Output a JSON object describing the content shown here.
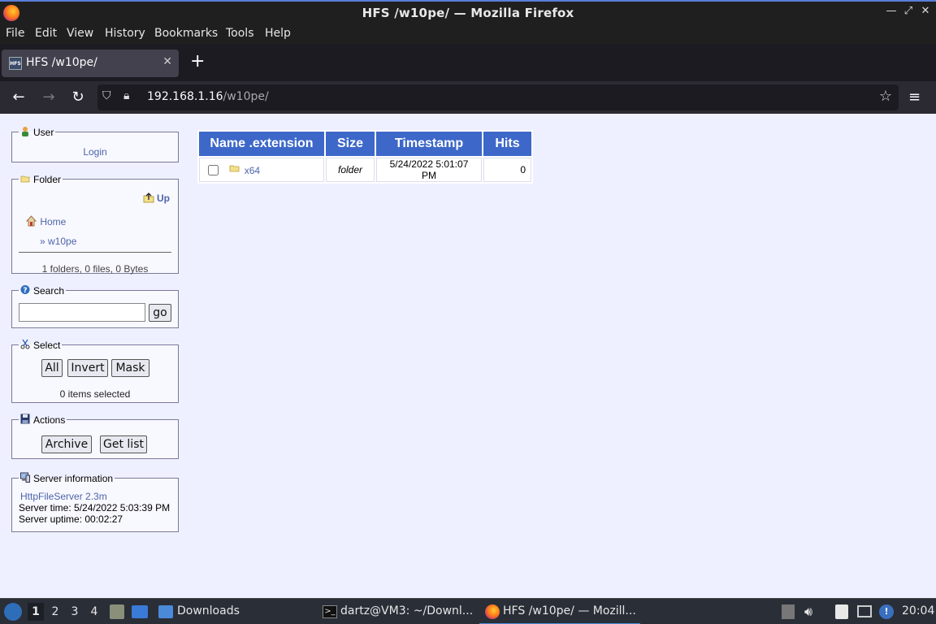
{
  "window": {
    "title": "HFS /w10pe/ — Mozilla Firefox"
  },
  "menu": [
    "File",
    "Edit",
    "View",
    "History",
    "Bookmarks",
    "Tools",
    "Help"
  ],
  "tab": {
    "label": "HFS /w10pe/",
    "favicon_text": "HFS"
  },
  "urlbar": {
    "host": "192.168.1.16",
    "path": "/w10pe/"
  },
  "user_panel": {
    "legend": "User",
    "login_link": "Login"
  },
  "folder_panel": {
    "legend": "Folder",
    "up_link": "Up",
    "home_link": "Home",
    "current": "» w10pe",
    "summary": "1 folders, 0 files, 0 Bytes"
  },
  "search_panel": {
    "legend": "Search",
    "input_value": "",
    "go_label": "go"
  },
  "select_panel": {
    "legend": "Select",
    "buttons": [
      "All",
      "Invert",
      "Mask"
    ],
    "status": "0 items selected"
  },
  "actions_panel": {
    "legend": "Actions",
    "buttons": [
      "Archive",
      "Get list"
    ]
  },
  "server_panel": {
    "legend": "Server information",
    "version_link": "HttpFileServer 2.3m",
    "server_time": "Server time: 5/24/2022 5:03:39 PM",
    "server_uptime": "Server uptime: 00:02:27"
  },
  "file_table": {
    "headers": [
      "Name .extension",
      "Size",
      "Timestamp",
      "Hits"
    ],
    "rows": [
      {
        "name": "x64",
        "size": "folder",
        "timestamp": "5/24/2022 5:01:07 PM",
        "hits": "0"
      }
    ]
  },
  "taskbar": {
    "workspaces": [
      "1",
      "2",
      "3",
      "4"
    ],
    "downloads_label": "Downloads",
    "terminal_task": "dartz@VM3: ~/Downl...",
    "firefox_task": "HFS /w10pe/ — Mozill...",
    "clock": "20:04"
  },
  "colors": {
    "table_header": "#3d68c9",
    "link": "#4d65a8",
    "page_background": "#eef0ff"
  }
}
